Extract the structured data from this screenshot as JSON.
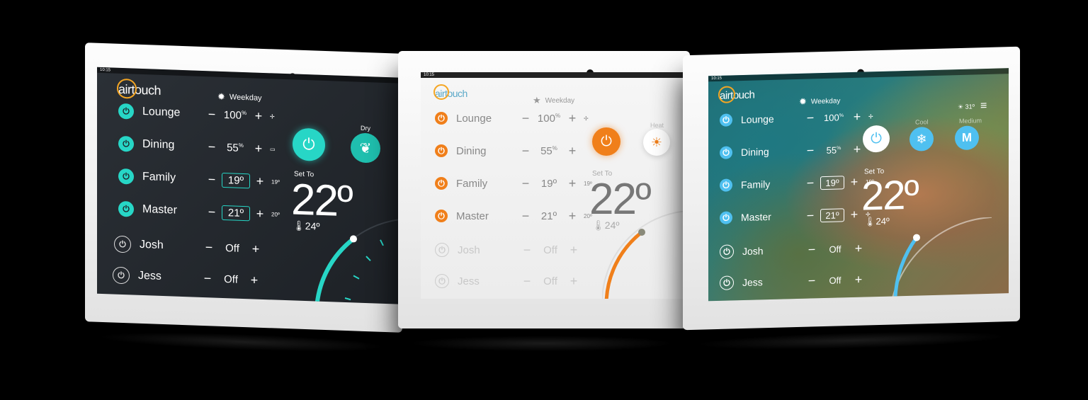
{
  "app": {
    "logo": "airtouch"
  },
  "status_time": "10:15",
  "schedule": "Weekday",
  "zones": [
    {
      "name": "Lounge",
      "value": "100",
      "unit": "%",
      "boxed": false,
      "extra": ""
    },
    {
      "name": "Dining",
      "value": "55",
      "unit": "%",
      "boxed": false,
      "extra": ""
    },
    {
      "name": "Family",
      "value": "19º",
      "unit": "",
      "boxed": true,
      "extra": "19º"
    },
    {
      "name": "Master",
      "value": "21º",
      "unit": "",
      "boxed": true,
      "extra": "20º"
    },
    {
      "name": "Josh",
      "value": "Off",
      "unit": "",
      "boxed": false,
      "extra": ""
    },
    {
      "name": "Jess",
      "value": "Off",
      "unit": "",
      "boxed": false,
      "extra": ""
    }
  ],
  "controls": {
    "minus": "−",
    "plus": "+"
  },
  "modes": {
    "dark": "Dry",
    "light": "Heat",
    "photo_mode": "Cool",
    "photo_fan": "Medium",
    "photo_fan_short": "M"
  },
  "set_to_label": "Set To",
  "set_temp": "22º",
  "room_temp": "24º",
  "outdoor_temp": "31º",
  "colors": {
    "teal": "#27d6c6",
    "orange": "#f07f1a",
    "blue": "#4fc0f0"
  }
}
